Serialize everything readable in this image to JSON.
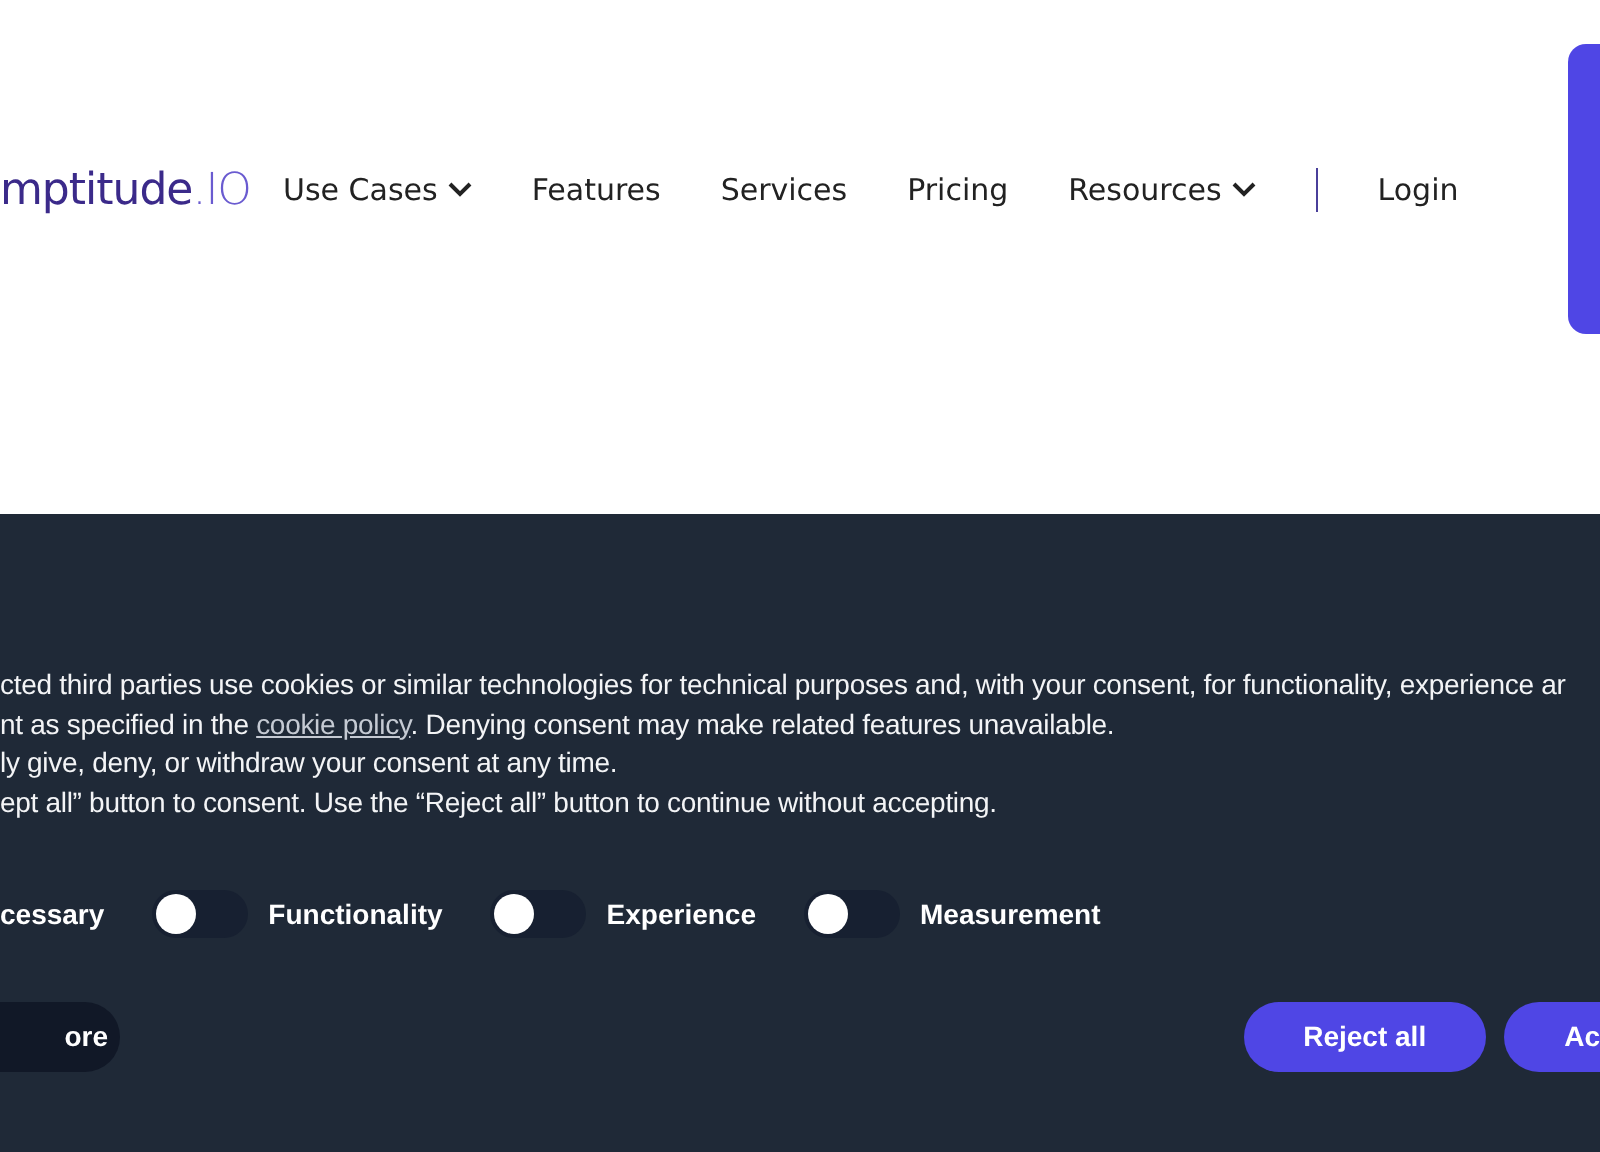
{
  "header": {
    "logo": {
      "main": "mptitude",
      "suffix": ".IO"
    },
    "nav": [
      {
        "label": "Use Cases",
        "dropdown": true
      },
      {
        "label": "Features",
        "dropdown": false
      },
      {
        "label": "Services",
        "dropdown": false
      },
      {
        "label": "Pricing",
        "dropdown": false
      },
      {
        "label": "Resources",
        "dropdown": true
      }
    ],
    "login": "Login"
  },
  "cookie_banner": {
    "lines": [
      {
        "text": "cted third parties use cookies or similar technologies for technical purposes and, with your consent, for functionality, experience ar"
      },
      {
        "text": "nt as specified in the ",
        "link": "cookie policy",
        "after": ". Denying consent may make related features unavailable."
      },
      {
        "text": "ly give, deny, or withdraw your consent at any time."
      },
      {
        "text": "ept all” button to consent. Use the “Reject all” button to continue without accepting."
      }
    ],
    "toggles": [
      {
        "kind": "label",
        "label": "cessary"
      },
      {
        "kind": "toggle",
        "label": "Functionality",
        "on": false
      },
      {
        "kind": "toggle",
        "label": "Experience",
        "on": false
      },
      {
        "kind": "toggle",
        "label": "Measurement",
        "on": false
      }
    ],
    "learn_more": "ore",
    "buttons": [
      "Reject all",
      "Ac"
    ]
  }
}
